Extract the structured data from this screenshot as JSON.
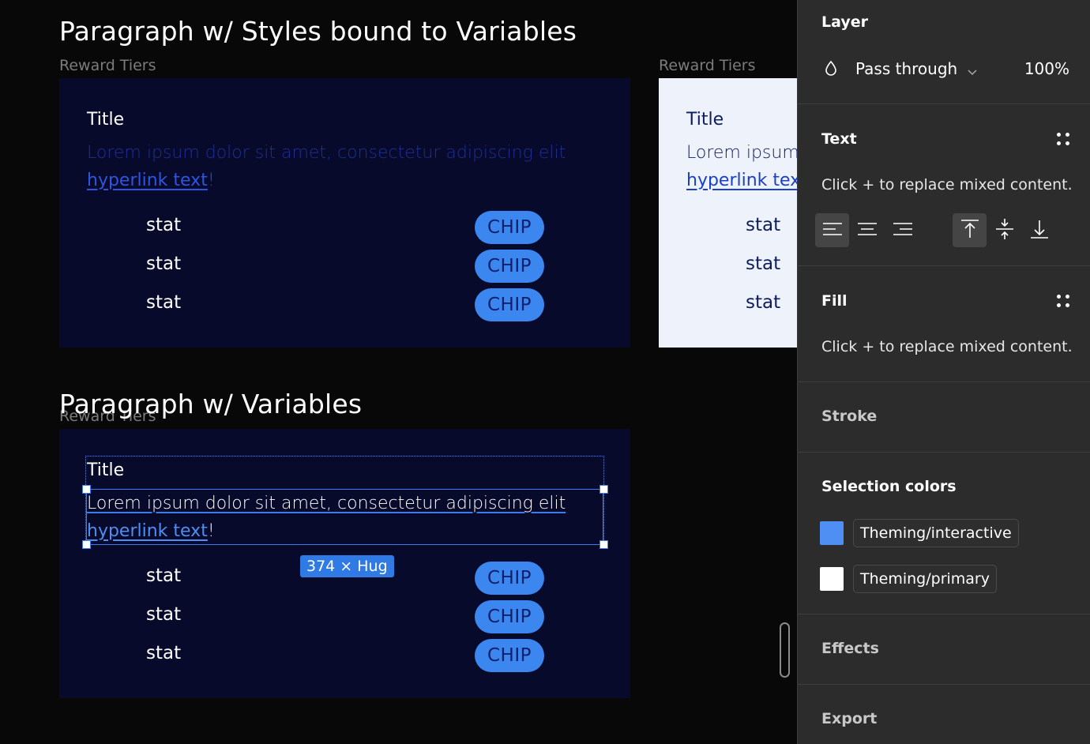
{
  "canvas": {
    "heading1": "Paragraph w/ Styles bound to Variables",
    "heading2": "Paragraph w/ Variables",
    "frame_label": "Reward Tiers",
    "card": {
      "title": "Title",
      "paragraph": "Lorem ipsum dolor sit amet, consectetur adipiscing elit",
      "hyperlink": "hyperlink text",
      "exclaim": "!",
      "stats": [
        "stat",
        "stat",
        "stat"
      ],
      "chips": [
        "CHIP",
        "CHIP",
        "CHIP"
      ]
    },
    "light_card": {
      "title": "Title",
      "paragraph": "Lorem ipsum",
      "hyperlink": "hyperlink tex"
    },
    "selection_size": "374 × Hug"
  },
  "panel": {
    "layer": {
      "title": "Layer",
      "blend_mode": "Pass through",
      "opacity": "100%"
    },
    "text": {
      "title": "Text",
      "mixed": "Click + to replace mixed content."
    },
    "fill": {
      "title": "Fill",
      "mixed": "Click + to replace mixed content."
    },
    "stroke": {
      "title": "Stroke"
    },
    "selection_colors": {
      "title": "Selection colors",
      "items": [
        {
          "label": "Theming/interactive",
          "color": "#4f8ef2"
        },
        {
          "label": "Theming/primary",
          "color": "#ffffff"
        }
      ]
    },
    "effects": {
      "title": "Effects"
    },
    "export": {
      "title": "Export"
    }
  },
  "colors": {
    "card_dark": "#070a2b",
    "chip_bg": "#3c86f0",
    "selection": "#3d7cec",
    "panel_bg": "#2c2c2c"
  }
}
